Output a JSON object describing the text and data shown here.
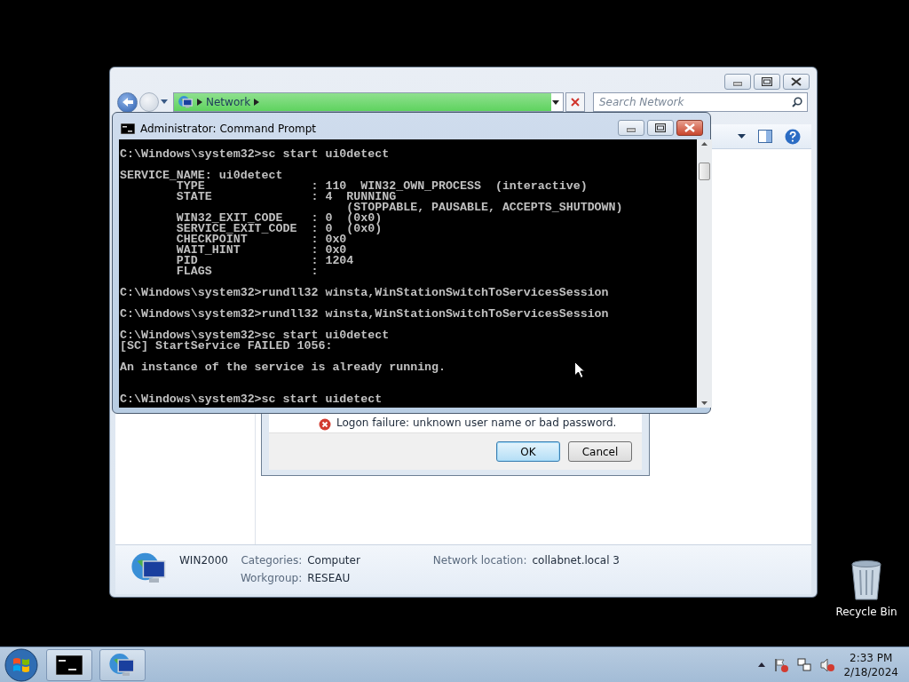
{
  "desktop": {
    "icons": [
      {
        "label": "Recycle Bin"
      }
    ]
  },
  "explorer": {
    "address_bar": {
      "crumbs": [
        "Network"
      ],
      "level": 0.97
    },
    "search": {
      "placeholder": "Search Network"
    },
    "details": {
      "name": "WIN2000",
      "columns": [
        [
          {
            "label": "Categories:",
            "value": "Computer"
          },
          {
            "label": "Workgroup:",
            "value": "RESEAU"
          }
        ],
        [
          {
            "label": "Network location:",
            "value": "collabnet.local  3"
          }
        ]
      ]
    }
  },
  "dialog": {
    "message": "Logon failure: unknown user name or bad password.",
    "buttons": [
      {
        "label": "OK",
        "default": true
      },
      {
        "label": "Cancel",
        "default": false
      }
    ]
  },
  "console": {
    "title": "Administrator:  Command Prompt",
    "blocks": [
      {
        "lines": [
          {
            "text": "C:\\Windows\\system32>sc start ui0detect"
          }
        ]
      },
      {
        "lines": [
          {
            "text": "SERVICE_NAME: ui0detect"
          },
          {
            "text": "        TYPE               : 110  WIN32_OWN_PROCESS  (interactive)"
          },
          {
            "text": "        STATE              : 4  RUNNING"
          },
          {
            "text": "                                (STOPPABLE, PAUSABLE, ACCEPTS_SHUTDOWN)"
          },
          {
            "text": "        WIN32_EXIT_CODE    : 0  (0x0)"
          },
          {
            "text": "        SERVICE_EXIT_CODE  : 0  (0x0)"
          },
          {
            "text": "        CHECKPOINT         : 0x0"
          },
          {
            "text": "        WAIT_HINT          : 0x0"
          },
          {
            "text": "        PID                : 1204"
          },
          {
            "text": "        FLAGS              :"
          }
        ]
      },
      {
        "lines": [
          {
            "text": "C:\\Windows\\system32>rundll32 winsta,WinStationSwitchToServicesSession"
          }
        ]
      },
      {
        "lines": [
          {
            "text": "C:\\Windows\\system32>rundll32 winsta,WinStationSwitchToServicesSession"
          }
        ]
      },
      {
        "lines": [
          {
            "text": "C:\\Windows\\system32>sc start ui0detect"
          },
          {
            "text": "[SC] StartService FAILED 1056:"
          }
        ]
      },
      {
        "lines": [
          {
            "text": "An instance of the service is already running."
          }
        ]
      },
      {
        "wide_gap": true,
        "lines": [
          {
            "text": "C:\\Windows\\system32>sc start uidetect"
          }
        ]
      }
    ]
  },
  "taskbar": {
    "buttons": [
      {
        "kind": "console"
      },
      {
        "kind": "network"
      }
    ],
    "clock": {
      "time": "2:33 PM",
      "date": "2/18/2024"
    }
  }
}
